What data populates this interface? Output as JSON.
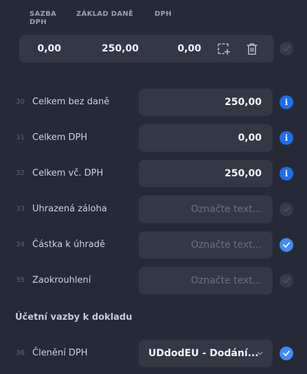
{
  "vat_table": {
    "headers": {
      "rate": "SAZBA\nDPH",
      "rate_l1": "SAZBA",
      "rate_l2": "DPH",
      "base": "ZÁKLAD DANĚ",
      "vat": "DPH"
    },
    "row": {
      "rate": "0,00",
      "base": "250,00",
      "vat": "0,00"
    }
  },
  "rows": [
    {
      "num": "30",
      "label": "Celkem bez daně",
      "value": "250,00",
      "placeholder": "",
      "indicator": "info"
    },
    {
      "num": "31",
      "label": "Celkem DPH",
      "value": "0,00",
      "placeholder": "",
      "indicator": "info"
    },
    {
      "num": "32",
      "label": "Celkem vč. DPH",
      "value": "250,00",
      "placeholder": "",
      "indicator": "info"
    },
    {
      "num": "33",
      "label": "Uhrazená záloha",
      "value": "",
      "placeholder": "Označte text...",
      "indicator": "check-dim"
    },
    {
      "num": "34",
      "label": "Částka k úhradě",
      "value": "",
      "placeholder": "Označte text...",
      "indicator": "check-on"
    },
    {
      "num": "35",
      "label": "Zaokrouhlení",
      "value": "",
      "placeholder": "Označte text...",
      "indicator": "check-dim"
    }
  ],
  "section_title": "Účetní vazby k dokladu",
  "vat_split": {
    "num": "36",
    "label": "Členění DPH",
    "value": "UDdodEU - Dodání...",
    "indicator": "check-on"
  },
  "info_glyph": "i",
  "colors": {
    "accent": "#3f8cf5",
    "info": "#1c6fe8",
    "background": "#262a37",
    "field": "#343845"
  }
}
